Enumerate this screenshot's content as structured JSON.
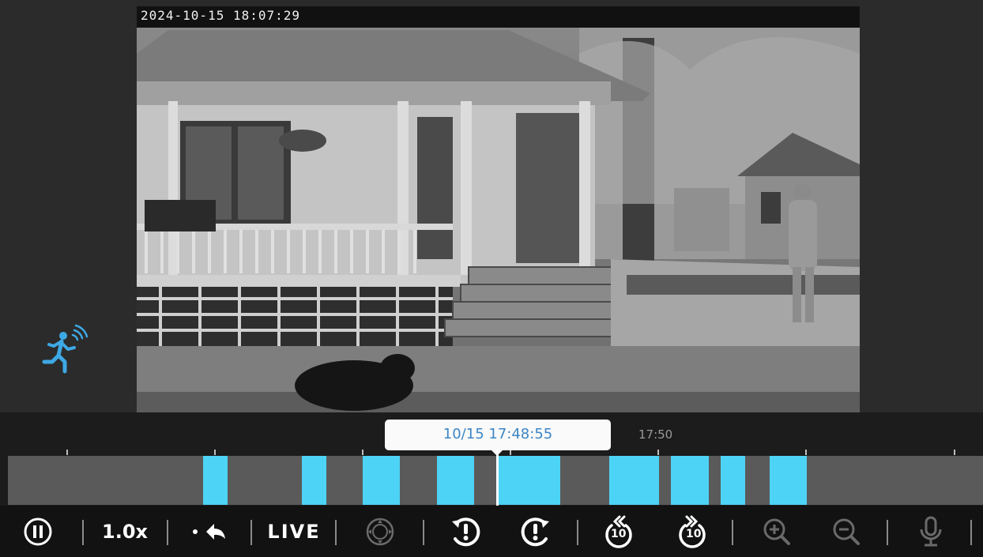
{
  "video": {
    "timestamp_overlay": "2024-10-15 18:07:29"
  },
  "motion_indicator": {
    "icon": "motion-detection-icon",
    "color": "#3ea8e5"
  },
  "timeline": {
    "current_time": "10/15 17:48:55",
    "tick_label": "17:50",
    "segment_color": "#4dd3f5",
    "track_color": "#5a5a5a"
  },
  "controls": {
    "pause_icon": "pause-icon",
    "speed_label": "1.0x",
    "back_to_live_icon": "back-to-event-icon",
    "live_label": "LIVE",
    "ptz_icon": "ptz-icon",
    "prev_event_icon": "previous-event-icon",
    "next_event_icon": "next-event-icon",
    "rewind_label": "10",
    "forward_label": "10",
    "zoom_in_icon": "zoom-in-icon",
    "zoom_out_icon": "zoom-out-icon",
    "mic_icon": "microphone-icon"
  }
}
